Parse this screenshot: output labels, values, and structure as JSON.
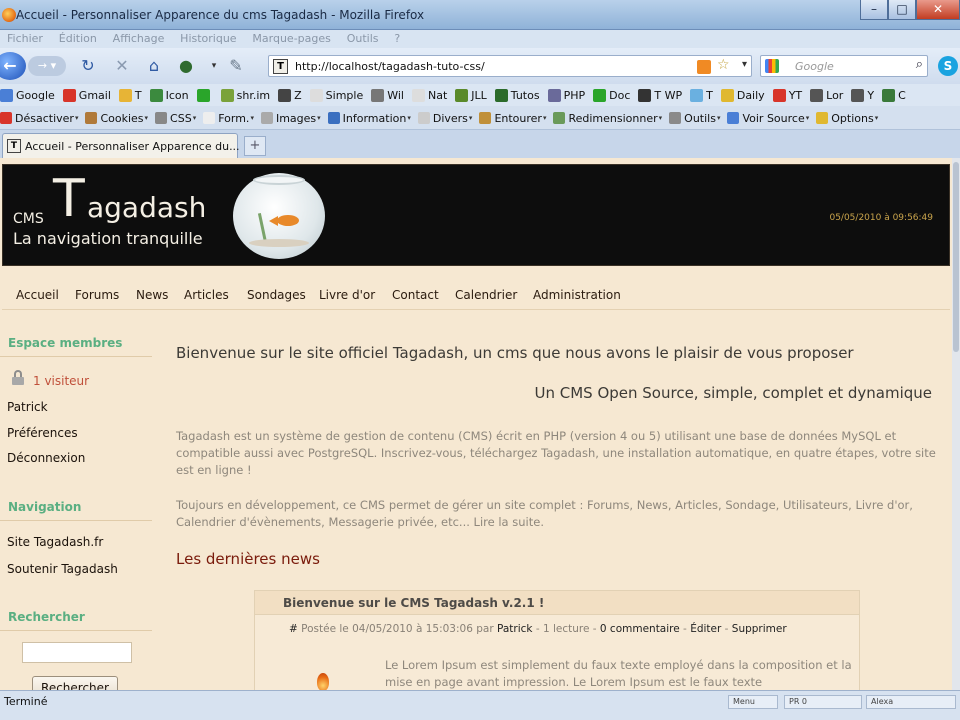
{
  "window": {
    "title": "Accueil - Personnaliser Apparence du cms Tagadash - Mozilla Firefox",
    "minimize": "–",
    "maximize": "□",
    "close": "✕"
  },
  "menu": [
    "Fichier",
    "Édition",
    "Affichage",
    "Historique",
    "Marque-pages",
    "Outils",
    "?"
  ],
  "nav": {
    "url": "http://localhost/tagadash-tuto-css/",
    "search_placeholder": "Google",
    "url_favicon": "T"
  },
  "bookmarks": [
    {
      "label": "Google",
      "color": "#4a7fd6"
    },
    {
      "label": "Gmail",
      "color": "#d8352a"
    },
    {
      "label": "T",
      "color": "#e7b436"
    },
    {
      "label": "Icon",
      "color": "#3b8a3e"
    },
    {
      "label": "",
      "color": "#2aa52a"
    },
    {
      "label": "shr.im",
      "color": "#7aa23a"
    },
    {
      "label": "Z",
      "color": "#444444"
    },
    {
      "label": "Simple",
      "color": "#dddddd"
    },
    {
      "label": "Wil",
      "color": "#777777"
    },
    {
      "label": "Nat",
      "color": "#dddddd"
    },
    {
      "label": "JLL",
      "color": "#5a8a2a"
    },
    {
      "label": "Tutos",
      "color": "#2b6b2b"
    },
    {
      "label": "PHP",
      "color": "#6a6a9a"
    },
    {
      "label": "Doc",
      "color": "#2aa52a"
    },
    {
      "label": "T WP",
      "color": "#333333"
    },
    {
      "label": "T",
      "color": "#6ab0e0"
    },
    {
      "label": "Daily",
      "color": "#e0b830"
    },
    {
      "label": "YT",
      "color": "#d8352a"
    },
    {
      "label": "Lor",
      "color": "#555555"
    },
    {
      "label": "Y",
      "color": "#555555"
    },
    {
      "label": "C",
      "color": "#3a7a3a"
    }
  ],
  "devtools": [
    {
      "label": "Désactiver",
      "color": "#d8352a"
    },
    {
      "label": "Cookies",
      "color": "#b07a3a"
    },
    {
      "label": "CSS",
      "color": "#888888"
    },
    {
      "label": "Form.",
      "color": "#eeeeee"
    },
    {
      "label": "Images",
      "color": "#aaaaaa"
    },
    {
      "label": "Information",
      "color": "#3a6fc0"
    },
    {
      "label": "Divers",
      "color": "#cccccc"
    },
    {
      "label": "Entourer",
      "color": "#c0903a"
    },
    {
      "label": "Redimensionner",
      "color": "#6a9a5a"
    },
    {
      "label": "Outils",
      "color": "#8a8a8a"
    },
    {
      "label": "Voir Source",
      "color": "#4a7fd6"
    },
    {
      "label": "Options",
      "color": "#e0b830"
    }
  ],
  "tab": {
    "label": "Accueil - Personnaliser Apparence du...",
    "favicon": "T",
    "new_tab": "+"
  },
  "site": {
    "logo_cms": "CMS",
    "logo_T": "T",
    "logo_rest": "agadash",
    "slogan": "La navigation tranquille",
    "datetime": "05/05/2010 à 09:56:49",
    "nav": [
      "Accueil",
      "Forums",
      "News",
      "Articles",
      "Sondages",
      "Livre d'or",
      "Contact",
      "Calendrier",
      "Administration"
    ]
  },
  "sidebar": {
    "members_heading": "Espace membres",
    "visitors": "1 visiteur",
    "links1": [
      "Patrick",
      "Préférences",
      "Déconnexion"
    ],
    "nav_heading": "Navigation",
    "links2": [
      "Site Tagadash.fr",
      "Soutenir Tagadash"
    ],
    "search_heading": "Rechercher",
    "search_button": "Rechercher"
  },
  "main": {
    "welcome": "Bienvenue sur le site officiel Tagadash, un cms que nous avons le plaisir de vous proposer",
    "tagline": "Un CMS Open Source, simple, complet et dynamique",
    "para1": "Tagadash est un système de gestion de contenu (CMS) écrit en PHP (version 4 ou 5) utilisant une base de données MySQL et compatible aussi avec PostgreSQL. Inscrivez-vous, téléchargez Tagadash, une installation automatique, en quatre étapes, votre site est en ligne !",
    "para2": "Toujours en développement, ce CMS permet de gérer un site complet : Forums, News, Articles, Sondage, Utilisateurs, Livre d'or, Calendrier d'évènements, Messagerie privée, etc... Lire la suite.",
    "news_heading": "Les dernières news",
    "news": {
      "title": "Bienvenue sur le CMS Tagadash v.2.1 !",
      "hash": "#",
      "posted": " Postée le 04/05/2010 à 15:03:06 par ",
      "author": "Patrick",
      "reads": " - 1 lecture - ",
      "comments": "0 commentaire",
      "sep1": " - ",
      "edit": "Éditer",
      "sep2": " - ",
      "delete": "Supprimer",
      "body": "Le Lorem Ipsum est simplement du faux texte employé dans la composition et la mise en page avant impression. Le Lorem Ipsum est le faux texte"
    }
  },
  "status": {
    "text": "Terminé",
    "cell1": "Menu",
    "cell2": "PR 0",
    "cell3": "Alexa"
  }
}
